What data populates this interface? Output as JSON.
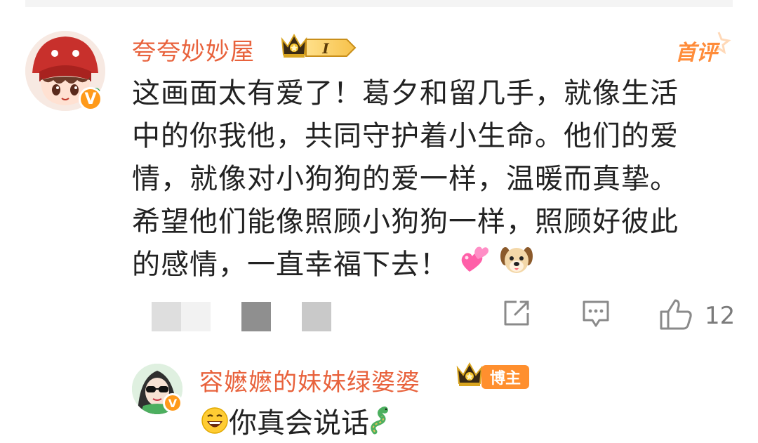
{
  "comment": {
    "author": "夸夸妙妙屋",
    "level_badge": "I",
    "top_badge": "首评",
    "lines": [
      "这画面太有爱了！葛夕和留几手，就像生活",
      "中的你我他，共同守护着小生命。他们的爱",
      "情，就像对小狗狗的爱一样，温暖而真挚。",
      "希望他们能像照顾小狗狗一样，照顾好彼此",
      "的感情，一直幸福下去！"
    ],
    "emojis": [
      "two-hearts-emoji",
      "dog-face-emoji"
    ],
    "like_count": "12",
    "verified_badge": "V"
  },
  "reply": {
    "author": "容嬷嬷的妹妹绿婆婆",
    "host_badge": "博主",
    "text": "你真会说话",
    "verified_badge": "V"
  },
  "colors": {
    "username": "#e8623c",
    "badge_orange": "#ff8f2e",
    "verified": "#ff9a1a",
    "text": "#222222",
    "icon_gray": "#8a8a8a"
  }
}
